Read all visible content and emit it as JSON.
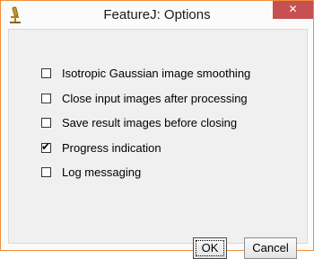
{
  "window": {
    "title": "FeatureJ: Options",
    "close_glyph": "✕",
    "app_icon": "microscope-icon"
  },
  "options": [
    {
      "label": "Isotropic Gaussian image smoothing",
      "checked": false
    },
    {
      "label": "Close input images after processing",
      "checked": false
    },
    {
      "label": "Save result images before closing",
      "checked": false
    },
    {
      "label": "Progress indication",
      "checked": true
    },
    {
      "label": "Log messaging",
      "checked": false
    }
  ],
  "check_glyph": "✔",
  "buttons": {
    "ok_label": "OK",
    "cancel_label": "Cancel"
  },
  "colors": {
    "window_border": "#f28e3a",
    "close_button": "#c75050"
  }
}
